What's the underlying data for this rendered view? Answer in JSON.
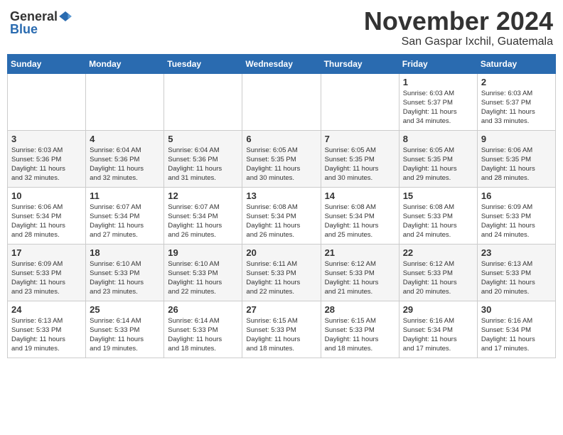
{
  "logo": {
    "general": "General",
    "blue": "Blue"
  },
  "header": {
    "month": "November 2024",
    "location": "San Gaspar Ixchil, Guatemala"
  },
  "weekdays": [
    "Sunday",
    "Monday",
    "Tuesday",
    "Wednesday",
    "Thursday",
    "Friday",
    "Saturday"
  ],
  "weeks": [
    [
      {
        "day": "",
        "info": ""
      },
      {
        "day": "",
        "info": ""
      },
      {
        "day": "",
        "info": ""
      },
      {
        "day": "",
        "info": ""
      },
      {
        "day": "",
        "info": ""
      },
      {
        "day": "1",
        "info": "Sunrise: 6:03 AM\nSunset: 5:37 PM\nDaylight: 11 hours\nand 34 minutes."
      },
      {
        "day": "2",
        "info": "Sunrise: 6:03 AM\nSunset: 5:37 PM\nDaylight: 11 hours\nand 33 minutes."
      }
    ],
    [
      {
        "day": "3",
        "info": "Sunrise: 6:03 AM\nSunset: 5:36 PM\nDaylight: 11 hours\nand 32 minutes."
      },
      {
        "day": "4",
        "info": "Sunrise: 6:04 AM\nSunset: 5:36 PM\nDaylight: 11 hours\nand 32 minutes."
      },
      {
        "day": "5",
        "info": "Sunrise: 6:04 AM\nSunset: 5:36 PM\nDaylight: 11 hours\nand 31 minutes."
      },
      {
        "day": "6",
        "info": "Sunrise: 6:05 AM\nSunset: 5:35 PM\nDaylight: 11 hours\nand 30 minutes."
      },
      {
        "day": "7",
        "info": "Sunrise: 6:05 AM\nSunset: 5:35 PM\nDaylight: 11 hours\nand 30 minutes."
      },
      {
        "day": "8",
        "info": "Sunrise: 6:05 AM\nSunset: 5:35 PM\nDaylight: 11 hours\nand 29 minutes."
      },
      {
        "day": "9",
        "info": "Sunrise: 6:06 AM\nSunset: 5:35 PM\nDaylight: 11 hours\nand 28 minutes."
      }
    ],
    [
      {
        "day": "10",
        "info": "Sunrise: 6:06 AM\nSunset: 5:34 PM\nDaylight: 11 hours\nand 28 minutes."
      },
      {
        "day": "11",
        "info": "Sunrise: 6:07 AM\nSunset: 5:34 PM\nDaylight: 11 hours\nand 27 minutes."
      },
      {
        "day": "12",
        "info": "Sunrise: 6:07 AM\nSunset: 5:34 PM\nDaylight: 11 hours\nand 26 minutes."
      },
      {
        "day": "13",
        "info": "Sunrise: 6:08 AM\nSunset: 5:34 PM\nDaylight: 11 hours\nand 26 minutes."
      },
      {
        "day": "14",
        "info": "Sunrise: 6:08 AM\nSunset: 5:34 PM\nDaylight: 11 hours\nand 25 minutes."
      },
      {
        "day": "15",
        "info": "Sunrise: 6:08 AM\nSunset: 5:33 PM\nDaylight: 11 hours\nand 24 minutes."
      },
      {
        "day": "16",
        "info": "Sunrise: 6:09 AM\nSunset: 5:33 PM\nDaylight: 11 hours\nand 24 minutes."
      }
    ],
    [
      {
        "day": "17",
        "info": "Sunrise: 6:09 AM\nSunset: 5:33 PM\nDaylight: 11 hours\nand 23 minutes."
      },
      {
        "day": "18",
        "info": "Sunrise: 6:10 AM\nSunset: 5:33 PM\nDaylight: 11 hours\nand 23 minutes."
      },
      {
        "day": "19",
        "info": "Sunrise: 6:10 AM\nSunset: 5:33 PM\nDaylight: 11 hours\nand 22 minutes."
      },
      {
        "day": "20",
        "info": "Sunrise: 6:11 AM\nSunset: 5:33 PM\nDaylight: 11 hours\nand 22 minutes."
      },
      {
        "day": "21",
        "info": "Sunrise: 6:12 AM\nSunset: 5:33 PM\nDaylight: 11 hours\nand 21 minutes."
      },
      {
        "day": "22",
        "info": "Sunrise: 6:12 AM\nSunset: 5:33 PM\nDaylight: 11 hours\nand 20 minutes."
      },
      {
        "day": "23",
        "info": "Sunrise: 6:13 AM\nSunset: 5:33 PM\nDaylight: 11 hours\nand 20 minutes."
      }
    ],
    [
      {
        "day": "24",
        "info": "Sunrise: 6:13 AM\nSunset: 5:33 PM\nDaylight: 11 hours\nand 19 minutes."
      },
      {
        "day": "25",
        "info": "Sunrise: 6:14 AM\nSunset: 5:33 PM\nDaylight: 11 hours\nand 19 minutes."
      },
      {
        "day": "26",
        "info": "Sunrise: 6:14 AM\nSunset: 5:33 PM\nDaylight: 11 hours\nand 18 minutes."
      },
      {
        "day": "27",
        "info": "Sunrise: 6:15 AM\nSunset: 5:33 PM\nDaylight: 11 hours\nand 18 minutes."
      },
      {
        "day": "28",
        "info": "Sunrise: 6:15 AM\nSunset: 5:33 PM\nDaylight: 11 hours\nand 18 minutes."
      },
      {
        "day": "29",
        "info": "Sunrise: 6:16 AM\nSunset: 5:34 PM\nDaylight: 11 hours\nand 17 minutes."
      },
      {
        "day": "30",
        "info": "Sunrise: 6:16 AM\nSunset: 5:34 PM\nDaylight: 11 hours\nand 17 minutes."
      }
    ]
  ]
}
